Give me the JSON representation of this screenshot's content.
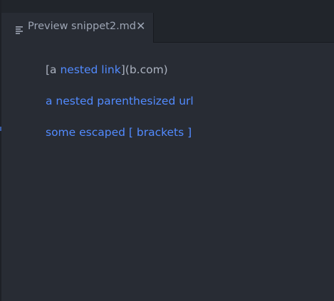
{
  "tab": {
    "title": "Preview snippet2.md",
    "close_glyph": "✕",
    "icon": "markdown-file-icon"
  },
  "preview": {
    "line1": {
      "prefix": "[a ",
      "link": "nested link",
      "suffix": "](b.com)"
    },
    "line2": {
      "link": "a nested parenthesized url"
    },
    "line3": {
      "link": "some escaped [ brackets ]"
    }
  },
  "colors": {
    "background": "#282c34",
    "tabbar": "#21252b",
    "text": "#abb2bf",
    "link": "#528bff"
  }
}
